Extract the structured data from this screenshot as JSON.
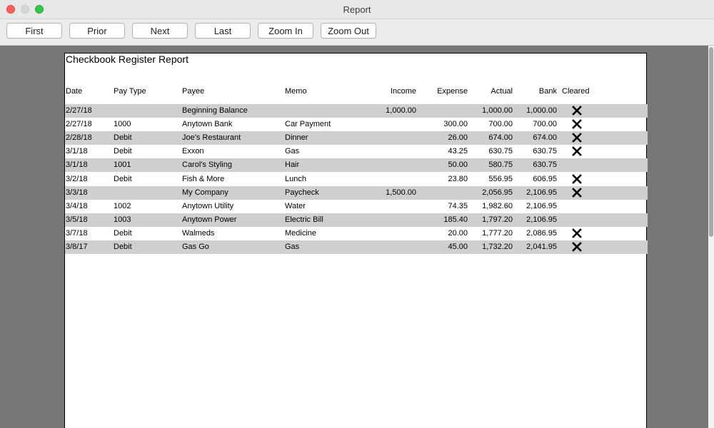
{
  "window": {
    "title": "Report"
  },
  "toolbar": {
    "first": "First",
    "prior": "Prior",
    "next": "Next",
    "last": "Last",
    "zoom_in": "Zoom In",
    "zoom_out": "Zoom Out"
  },
  "report": {
    "title": "Checkbook Register Report",
    "columns": {
      "date": "Date",
      "pay_type": "Pay Type",
      "payee": "Payee",
      "memo": "Memo",
      "income": "Income",
      "expense": "Expense",
      "actual": "Actual",
      "bank": "Bank",
      "cleared": "Cleared"
    },
    "rows": [
      {
        "date": "2/27/18",
        "pay_type": "",
        "payee": "Beginning Balance",
        "memo": "",
        "income": "1,000.00",
        "expense": "",
        "actual": "1,000.00",
        "bank": "1,000.00",
        "cleared": true
      },
      {
        "date": "2/27/18",
        "pay_type": "1000",
        "payee": "Anytown Bank",
        "memo": "Car Payment",
        "income": "",
        "expense": "300.00",
        "actual": "700.00",
        "bank": "700.00",
        "cleared": true
      },
      {
        "date": "2/28/18",
        "pay_type": "Debit",
        "payee": "Joe's Restaurant",
        "memo": "Dinner",
        "income": "",
        "expense": "26.00",
        "actual": "674.00",
        "bank": "674.00",
        "cleared": true
      },
      {
        "date": "3/1/18",
        "pay_type": "Debit",
        "payee": "Exxon",
        "memo": "Gas",
        "income": "",
        "expense": "43.25",
        "actual": "630.75",
        "bank": "630.75",
        "cleared": true
      },
      {
        "date": "3/1/18",
        "pay_type": "1001",
        "payee": "Carol's Styling",
        "memo": "Hair",
        "income": "",
        "expense": "50.00",
        "actual": "580.75",
        "bank": "630.75",
        "cleared": false
      },
      {
        "date": "3/2/18",
        "pay_type": "Debit",
        "payee": "Fish & More",
        "memo": "Lunch",
        "income": "",
        "expense": "23.80",
        "actual": "556.95",
        "bank": "606.95",
        "cleared": true
      },
      {
        "date": "3/3/18",
        "pay_type": "",
        "payee": "My Company",
        "memo": "Paycheck",
        "income": "1,500.00",
        "expense": "",
        "actual": "2,056.95",
        "bank": "2,106.95",
        "cleared": true
      },
      {
        "date": "3/4/18",
        "pay_type": "1002",
        "payee": "Anytown Utility",
        "memo": "Water",
        "income": "",
        "expense": "74.35",
        "actual": "1,982.60",
        "bank": "2,106.95",
        "cleared": false
      },
      {
        "date": "3/5/18",
        "pay_type": "1003",
        "payee": "Anytown Power",
        "memo": "Electric Bill",
        "income": "",
        "expense": "185.40",
        "actual": "1,797.20",
        "bank": "2,106.95",
        "cleared": false
      },
      {
        "date": "3/7/18",
        "pay_type": "Debit",
        "payee": "Walmeds",
        "memo": "Medicine",
        "income": "",
        "expense": "20.00",
        "actual": "1,777.20",
        "bank": "2,086.95",
        "cleared": true
      },
      {
        "date": "3/8/17",
        "pay_type": "Debit",
        "payee": "Gas Go",
        "memo": "Gas",
        "income": "",
        "expense": "45.00",
        "actual": "1,732.20",
        "bank": "2,041.95",
        "cleared": true
      }
    ]
  },
  "icons": {
    "cleared": "x-mark-icon"
  },
  "colors": {
    "shaded_row": "#cfcfcf",
    "viewport_bg": "#777777"
  }
}
